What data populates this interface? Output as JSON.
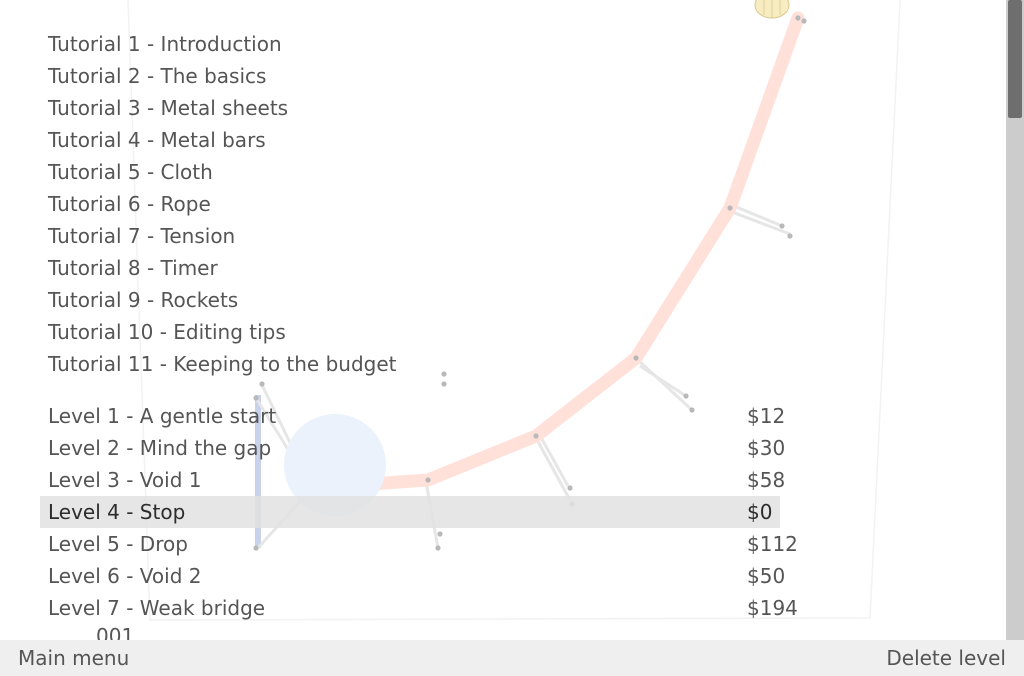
{
  "tutorials": [
    {
      "label": "Tutorial 1 - Introduction"
    },
    {
      "label": "Tutorial 2 - The basics"
    },
    {
      "label": "Tutorial 3 - Metal sheets"
    },
    {
      "label": "Tutorial 4 - Metal bars"
    },
    {
      "label": "Tutorial 5 - Cloth"
    },
    {
      "label": "Tutorial 6 - Rope"
    },
    {
      "label": "Tutorial 7 - Tension"
    },
    {
      "label": "Tutorial 8 - Timer"
    },
    {
      "label": "Tutorial 9 - Rockets"
    },
    {
      "label": "Tutorial 10 - Editing tips"
    },
    {
      "label": "Tutorial 11 - Keeping to the budget"
    }
  ],
  "levels": [
    {
      "label": "Level 1 - A gentle start",
      "cost": "$12"
    },
    {
      "label": "Level 2 - Mind the gap",
      "cost": "$30"
    },
    {
      "label": "Level 3 - Void 1",
      "cost": "$58"
    },
    {
      "label": "Level 4 - Stop",
      "cost": "$0",
      "selected": true
    },
    {
      "label": "Level 5 - Drop",
      "cost": "$112"
    },
    {
      "label": "Level 6 - Void 2",
      "cost": "$50"
    },
    {
      "label": "Level 7 - Weak bridge",
      "cost": "$194"
    }
  ],
  "partial_next_item": "001",
  "footer": {
    "main_menu_label": "Main menu",
    "delete_level_label": "Delete level"
  },
  "colors": {
    "selected_row": "#e2e2e2",
    "text": "#555555",
    "footer_bg": "#efefef",
    "rope": "#ffd9d0",
    "scrollbar_track": "#cccccc",
    "scrollbar_thumb": "#6e6e6e"
  }
}
